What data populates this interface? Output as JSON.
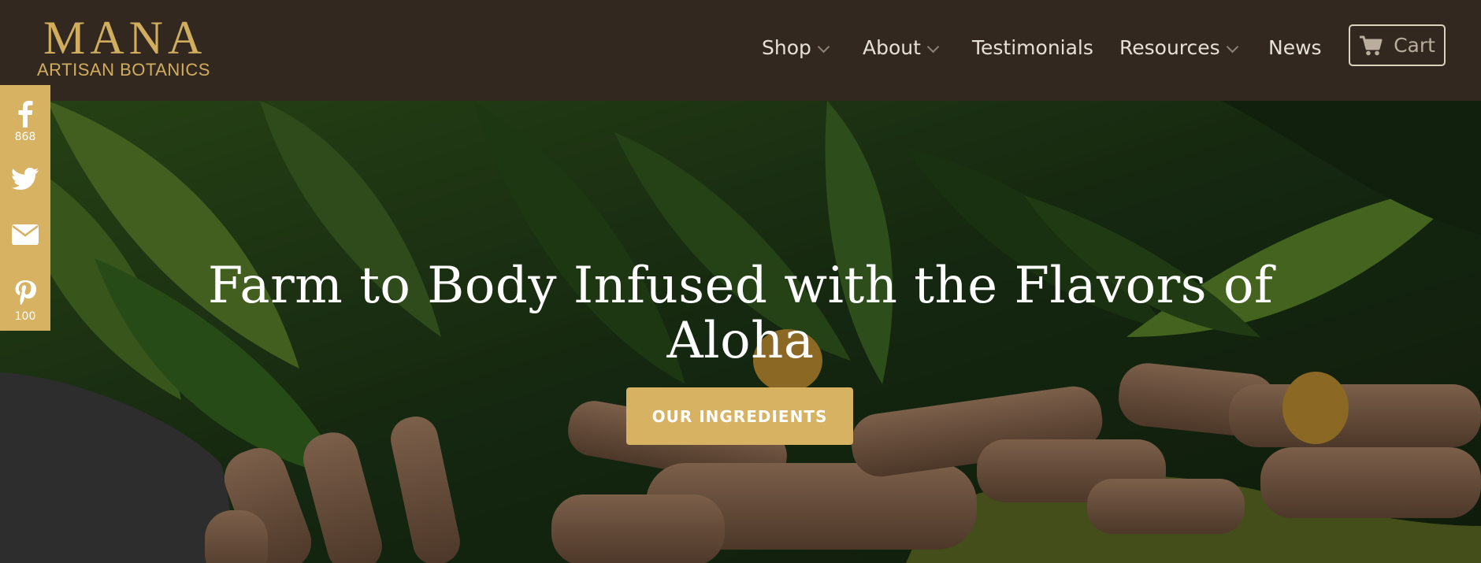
{
  "brand": {
    "wordmark": "MANA",
    "subtitle": "ARTISAN BOTANICS",
    "gold": "#d1ad5e"
  },
  "nav": {
    "items": [
      {
        "label": "Shop",
        "has_dropdown": true
      },
      {
        "label": "About",
        "has_dropdown": true
      },
      {
        "label": "Testimonials",
        "has_dropdown": false
      },
      {
        "label": "Resources",
        "has_dropdown": true
      },
      {
        "label": "News",
        "has_dropdown": false
      }
    ],
    "cart_label": "Cart"
  },
  "hero": {
    "title": "Farm to Body Infused with the Flavors of Aloha",
    "cta_label": "OUR INGREDIENTS"
  },
  "share": {
    "items": [
      {
        "icon": "facebook-icon",
        "count": "868"
      },
      {
        "icon": "twitter-icon",
        "count": ""
      },
      {
        "icon": "email-icon",
        "count": ""
      },
      {
        "icon": "pinterest-icon",
        "count": "100"
      }
    ]
  },
  "colors": {
    "header_bg": "#332820",
    "accent": "#d6b262",
    "nav_text": "#e6e0d7"
  }
}
